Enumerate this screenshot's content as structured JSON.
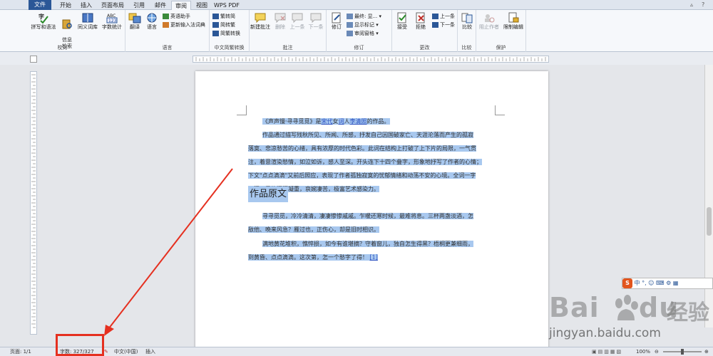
{
  "tabs": [
    "文件",
    "开始",
    "插入",
    "页面布局",
    "引用",
    "邮件",
    "审阅",
    "视图",
    "WPS PDF"
  ],
  "ribbon": {
    "proofing": {
      "label": "校对",
      "spelling": "拼写和语法",
      "info_search": "信息\n检索",
      "thesaurus": "同义词库",
      "word_count": "字数统计"
    },
    "language": {
      "label": "语言",
      "translate": "翻译",
      "language": "语言",
      "english_assist": "英语助手",
      "update_ime": "更新输入法词典"
    },
    "chinese_conv": {
      "label": "中文简繁转换",
      "to_simplified": "繁转简",
      "to_traditional": "简转繁",
      "conversion": "简繁转换"
    },
    "comments": {
      "label": "批注",
      "new": "新建批注",
      "delete": "删除",
      "prev": "上一条",
      "next": "下一条"
    },
    "tracking": {
      "label": "修订",
      "track": "修订",
      "final": "最终: 显...",
      "show_markup": "显示标记",
      "pane": "审阅窗格"
    },
    "changes": {
      "label": "更改",
      "accept": "接受",
      "reject": "拒绝",
      "prev": "上一条",
      "next": "下一条"
    },
    "compare": {
      "label": "比较",
      "compare": "比较"
    },
    "protect": {
      "label": "保护",
      "block_authors": "阻止作者",
      "restrict": "限制编辑"
    }
  },
  "document": {
    "para1_a": "《声声慢·寻寻觅觅》是",
    "para1_link1": "宋代",
    "para1_b": "女",
    "para1_link2": "词",
    "para1_c": "人",
    "para1_link3": "李清照",
    "para1_d": "的作品。",
    "para2_l1": "作品通过描写残秋所见、所闻、所感，抒发自己因国破家亡、天涯沦落而产生的孤寂",
    "para2_l2": "落寞、悲凉愁苦的心绪，具有浓厚的时代色彩。此词在结构上打破了上下片的局限，一气贯",
    "para2_l3": "注，着意渲染愁情，如泣如诉，感人至深。开头连下十四个叠字，形象地抒写了作者的心情；",
    "para2_l4": "下文\"点点滴滴\"又前后照应，表现了作者孤独寂寞的忧郁情绪和动荡不安的心境。全词一字",
    "para2_l5": "一泪，风格深沉凝重，哀婉凄苦，极富艺术感染力。",
    "heading": "作品原文",
    "poem1_l1": "寻寻觅觅，冷冷清清，凄凄惨惨戚戚。乍暖还寒时候，最难将息。三杯两盏淡酒，怎",
    "poem1_l2": "敌他、晚来风急？雁过也，正伤心，却是旧时相识。",
    "poem2_l1": "满地黄花堆积，憔悴损，如今有谁堪摘？守着窗儿，独自怎生得黑？梧桐更兼细雨，",
    "poem2_l2": "到黄昏、点点滴滴。这次第，怎一个愁字了得！",
    "footnote": "[1]"
  },
  "ime_bar": {
    "logo": "S",
    "text": "中 °, ☺ ⌨ ⚙ ▦"
  },
  "watermark": {
    "logo_text": "Bai",
    "logo_cn": "经验",
    "url": "jingyan.baidu.com"
  },
  "status": {
    "page": "页面: 1/1",
    "word_count": "字数: 327/327",
    "language": "中文(中国)",
    "mode": "插入",
    "zoom": "100%"
  },
  "accent_colors": {
    "file_tab": "#2b5797",
    "selection": "#a8c8ef",
    "annotation": "#e53020"
  }
}
